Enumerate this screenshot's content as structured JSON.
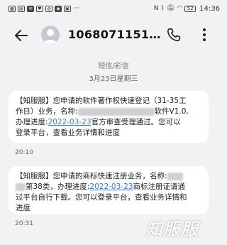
{
  "status_bar": {
    "left_icons": [
      "sim-icon",
      "grid-icon",
      "message-icon",
      "heart-icon",
      "bubble-icon",
      "qq-icon",
      "image-icon",
      "dots-icon"
    ],
    "right_icons": [
      "nfc-icon",
      "bluetooth-icon",
      "silent-icon",
      "wifi-icon"
    ],
    "battery": "52",
    "time": "14:36"
  },
  "header": {
    "contact": "1068071151…",
    "back_icon": "back-arrow-icon",
    "call_icon": "phone-icon",
    "more_icon": "more-vertical-icon"
  },
  "meta": {
    "type": "短信/彩信",
    "date": "3月23日星期三"
  },
  "messages": [
    {
      "line1": "【知服服】您申请的软件著作权快速登记（31-35工",
      "line2": "作日）业务，名称:",
      "line2_after": "软件V1.0,",
      "line3_prefix": "办理进度:",
      "line3_date": "2022-03-23",
      "line3_suffix": "官方审查受理通过。您可以",
      "line4": "登录平台，查看业务详情和进度",
      "time": "20:10"
    },
    {
      "line1": "【知服服】您申请的商标快速注册业务，名称:",
      "line2_prefix": "第38类，办理进度:",
      "line2_date": "2022-03-23",
      "line2_suffix": "商标注册证请通",
      "line3": "过平台自行下载。您可以登录平台，查看业务详情和",
      "line4": "进度",
      "time": "20:31"
    }
  ],
  "watermark": "知服服",
  "colors": {
    "background": "#f1f2f3",
    "bubble": "#ffffff",
    "link": "#3a7bd5"
  }
}
